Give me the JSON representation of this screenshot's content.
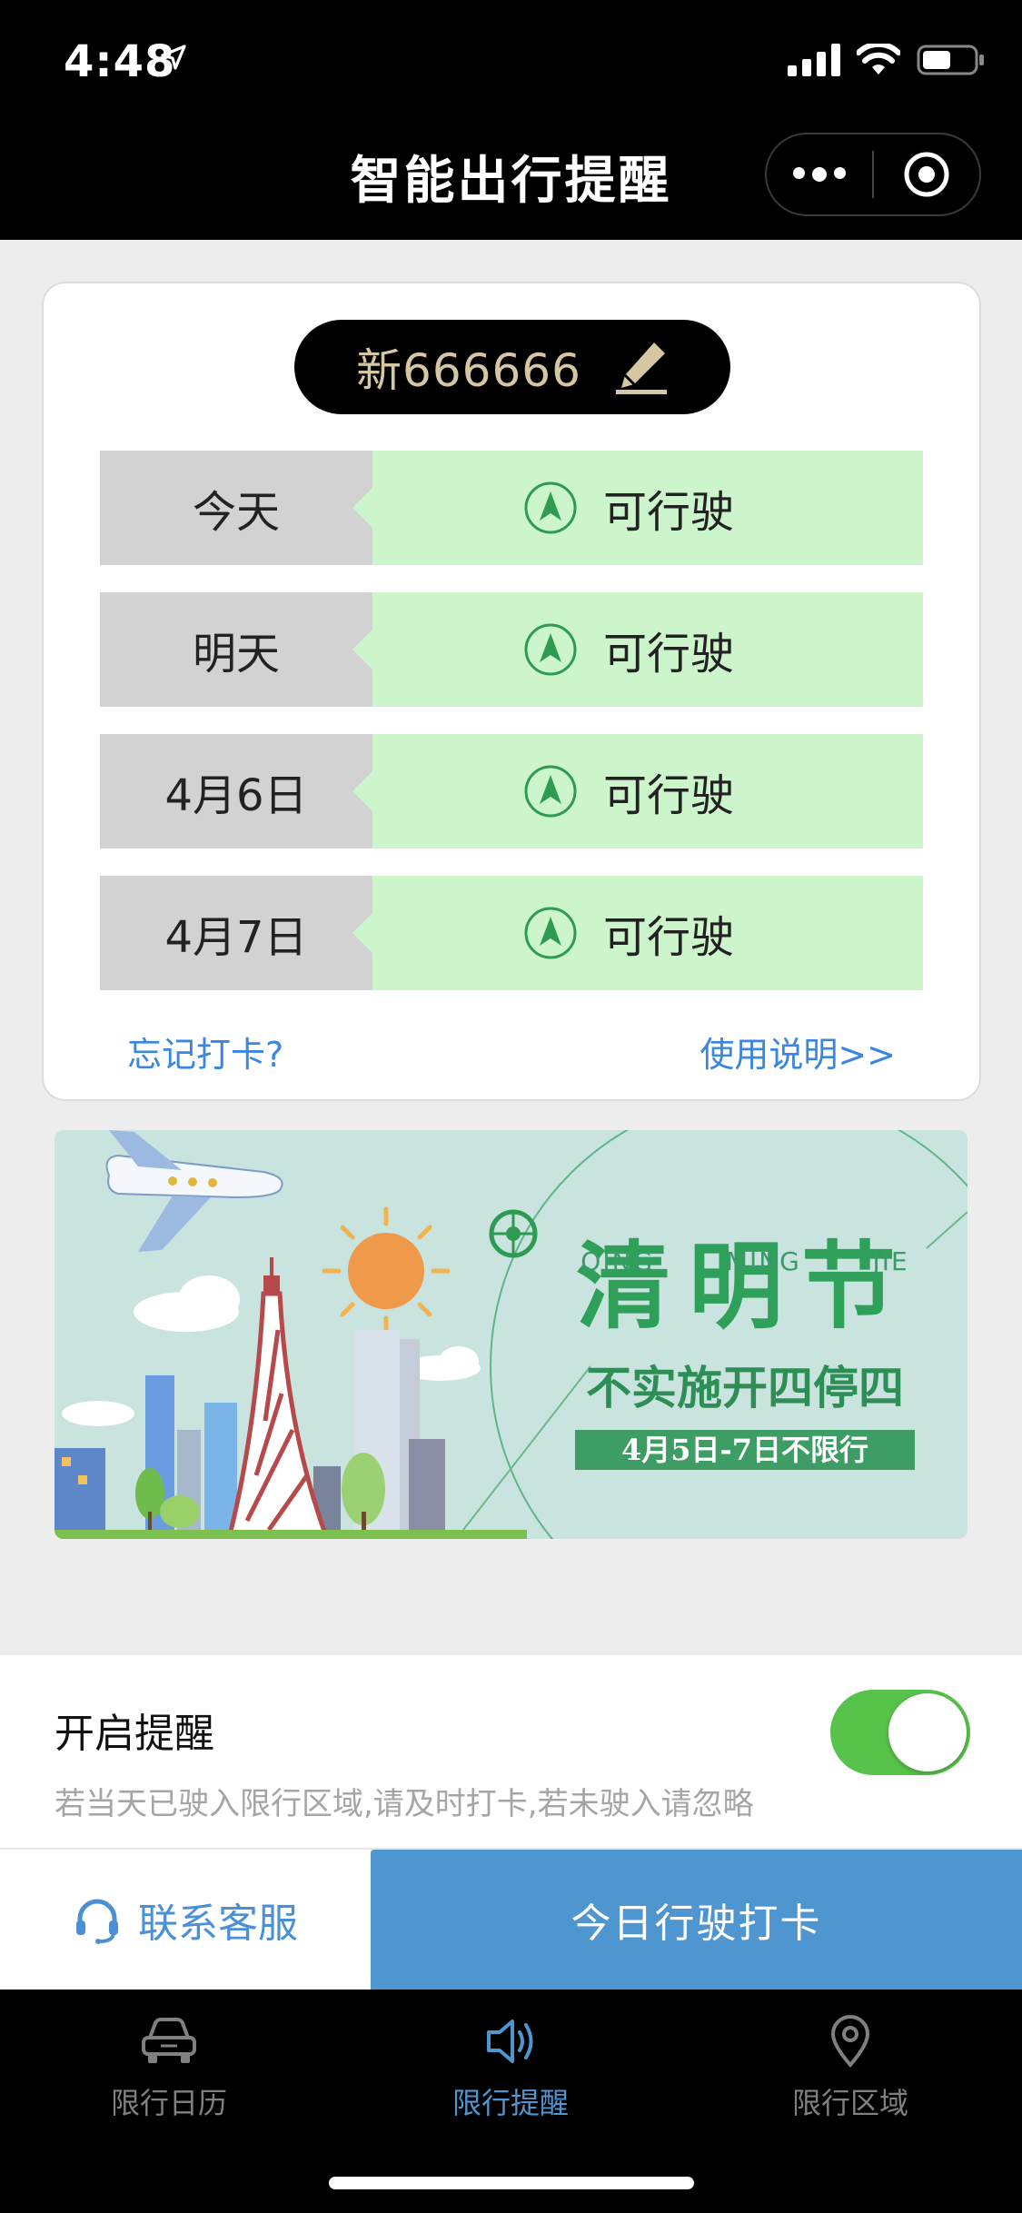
{
  "status_bar": {
    "time": "4:48"
  },
  "nav": {
    "title": "智能出行提醒"
  },
  "plate": {
    "number": "新666666"
  },
  "schedule": [
    {
      "day": "今天",
      "status": "可行驶"
    },
    {
      "day": "明天",
      "status": "可行驶"
    },
    {
      "day": "4月6日",
      "status": "可行驶"
    },
    {
      "day": "4月7日",
      "status": "可行驶"
    }
  ],
  "card_links": {
    "forgot": "忘记打卡?",
    "instructions": "使用说明>>"
  },
  "banner": {
    "title": "清明节",
    "pinyin": [
      "QING",
      "MING",
      "JIE"
    ],
    "subtitle": "不实施开四停四",
    "tag": "4月5日-7日不限行"
  },
  "reminder": {
    "title": "开启提醒",
    "description": "若当天已驶入限行区域,请及时打卡,若未驶入请忽略",
    "enabled": true
  },
  "actions": {
    "service": "联系客服",
    "checkin": "今日行驶打卡"
  },
  "tabs": [
    {
      "label": "限行日历",
      "icon": "car-icon",
      "active": false
    },
    {
      "label": "限行提醒",
      "icon": "speaker-icon",
      "active": true
    },
    {
      "label": "限行区域",
      "icon": "location-pin-icon",
      "active": false
    }
  ],
  "colors": {
    "accent": "#4f95d0",
    "ok_bg": "#cdf5cc",
    "ok_icon": "#2e9a52",
    "toggle_on": "#58c34a",
    "link": "#3b86e0"
  }
}
